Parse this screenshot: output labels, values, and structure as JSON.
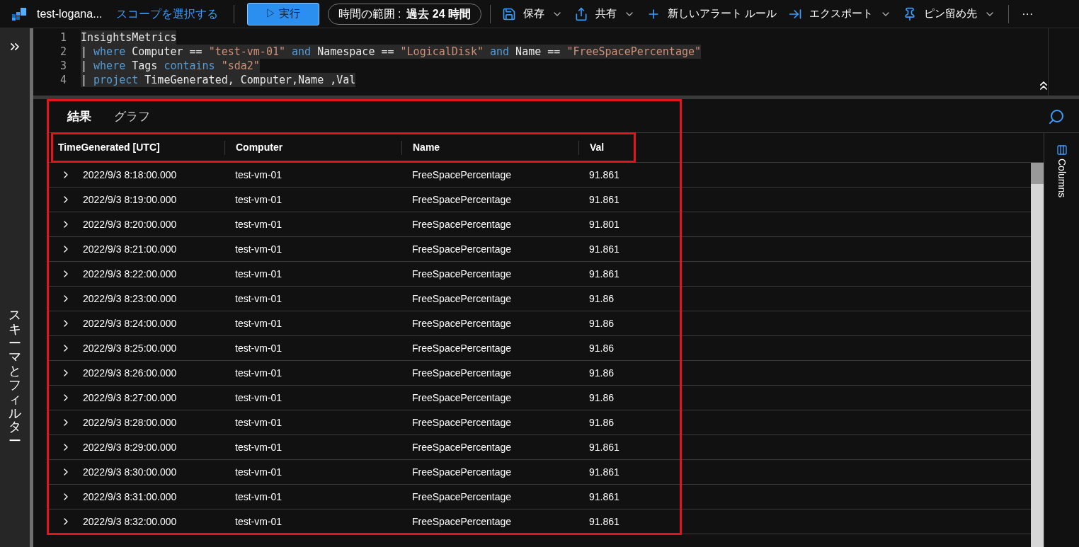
{
  "toolbar": {
    "workspace": "test-logana...",
    "scope_link": "スコープを選択する",
    "run_button": "▷ 実行",
    "time_range": {
      "label": "時間の範囲 :",
      "value": "過去 24 時間"
    },
    "actions": [
      {
        "kind": "save",
        "label": "保存",
        "dropdown": true
      },
      {
        "kind": "share",
        "label": "共有",
        "dropdown": true
      },
      {
        "kind": "alert",
        "label": "新しいアラート ルール",
        "dropdown": false
      },
      {
        "kind": "export",
        "label": "エクスポート",
        "dropdown": true
      },
      {
        "kind": "pin",
        "label": "ピン留め先",
        "dropdown": true
      }
    ],
    "more": "···"
  },
  "sidebar": {
    "label": "スキーマとフィルター"
  },
  "editor": {
    "lines": [
      {
        "number": "1",
        "tokens": [
          {
            "kind": "plain",
            "text": "InsightsMetrics"
          }
        ]
      },
      {
        "number": "2",
        "tokens": [
          {
            "kind": "pipe",
            "text": "| "
          },
          {
            "kind": "keyword",
            "text": "where"
          },
          {
            "kind": "plain",
            "text": " Computer == "
          },
          {
            "kind": "string",
            "text": "\"test-vm-01\""
          },
          {
            "kind": "keyword",
            "text": " and"
          },
          {
            "kind": "plain",
            "text": " Namespace == "
          },
          {
            "kind": "string",
            "text": "\"LogicalDisk\""
          },
          {
            "kind": "keyword",
            "text": " and"
          },
          {
            "kind": "plain",
            "text": " Name == "
          },
          {
            "kind": "string",
            "text": "\"FreeSpacePercentage\""
          }
        ]
      },
      {
        "number": "3",
        "tokens": [
          {
            "kind": "pipe",
            "text": "| "
          },
          {
            "kind": "keyword",
            "text": "where"
          },
          {
            "kind": "plain",
            "text": " Tags "
          },
          {
            "kind": "keyword",
            "text": "contains"
          },
          {
            "kind": "string",
            "text": " \"sda2\""
          }
        ]
      },
      {
        "number": "4",
        "tokens": [
          {
            "kind": "pipe",
            "text": "| "
          },
          {
            "kind": "keyword",
            "text": "project"
          },
          {
            "kind": "plain",
            "text": " TimeGenerated, Computer,Name ,Val"
          }
        ]
      }
    ]
  },
  "results": {
    "tabs": [
      {
        "label": "結果",
        "selected": true
      },
      {
        "label": "グラフ",
        "selected": false
      }
    ],
    "columns_panel": "Columns",
    "table": {
      "columns": [
        "TimeGenerated [UTC]",
        "Computer",
        "Name",
        "Val"
      ],
      "rows": [
        [
          "2022/9/3 8:18:00.000",
          "test-vm-01",
          "FreeSpacePercentage",
          "91.861"
        ],
        [
          "2022/9/3 8:19:00.000",
          "test-vm-01",
          "FreeSpacePercentage",
          "91.861"
        ],
        [
          "2022/9/3 8:20:00.000",
          "test-vm-01",
          "FreeSpacePercentage",
          "91.801"
        ],
        [
          "2022/9/3 8:21:00.000",
          "test-vm-01",
          "FreeSpacePercentage",
          "91.861"
        ],
        [
          "2022/9/3 8:22:00.000",
          "test-vm-01",
          "FreeSpacePercentage",
          "91.861"
        ],
        [
          "2022/9/3 8:23:00.000",
          "test-vm-01",
          "FreeSpacePercentage",
          "91.86"
        ],
        [
          "2022/9/3 8:24:00.000",
          "test-vm-01",
          "FreeSpacePercentage",
          "91.86"
        ],
        [
          "2022/9/3 8:25:00.000",
          "test-vm-01",
          "FreeSpacePercentage",
          "91.86"
        ],
        [
          "2022/9/3 8:26:00.000",
          "test-vm-01",
          "FreeSpacePercentage",
          "91.86"
        ],
        [
          "2022/9/3 8:27:00.000",
          "test-vm-01",
          "FreeSpacePercentage",
          "91.86"
        ],
        [
          "2022/9/3 8:28:00.000",
          "test-vm-01",
          "FreeSpacePercentage",
          "91.86"
        ],
        [
          "2022/9/3 8:29:00.000",
          "test-vm-01",
          "FreeSpacePercentage",
          "91.861"
        ],
        [
          "2022/9/3 8:30:00.000",
          "test-vm-01",
          "FreeSpacePercentage",
          "91.861"
        ],
        [
          "2022/9/3 8:31:00.000",
          "test-vm-01",
          "FreeSpacePercentage",
          "91.861"
        ],
        [
          "2022/9/3 8:32:00.000",
          "test-vm-01",
          "FreeSpacePercentage",
          "91.861"
        ]
      ]
    }
  }
}
